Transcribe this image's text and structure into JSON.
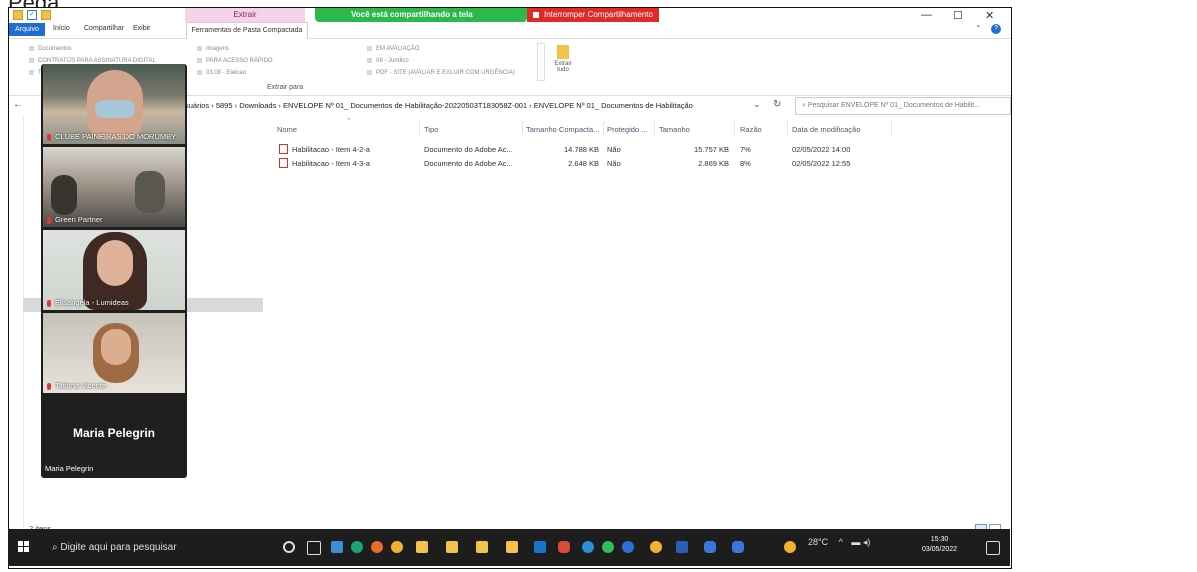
{
  "page": {
    "top_fragment": "Pega"
  },
  "window": {
    "extrair_tab": "Extrair",
    "share_notice": "Você está compartilhando a tela",
    "stop_share": "Interromper Compartilhamento",
    "minimize": "—",
    "maximize": "☐",
    "close": "✕"
  },
  "ribbon": {
    "tabs": [
      "Arquivo",
      "Início",
      "Compartilhar",
      "Exibir"
    ],
    "contextual_tab": "Ferramentas de Pasta Compactada",
    "help": "?",
    "collapse": "⌃",
    "group1": [
      "Documentos",
      "CONTRATOS PARA ASSINATURA DIGITAL",
      "TRAB"
    ],
    "group2": [
      "Imagens",
      "PARA ACESSO RÁPIDO",
      "03.08 - Eleicao"
    ],
    "group3": [
      "EM AVALIAÇÃO",
      "08 - Juridico",
      "PDF - SITE (AVALIAR E EXLUIR COM URGÊNCIA)"
    ],
    "extrair_tudo": "Extrair tudo",
    "extrair_para": "Extrair para"
  },
  "address": {
    "back": "←",
    "path": "suários  ›  5895  ›  Downloads  ›  ENVELOPE Nº 01_ Documentos de Habilitação-20220503T183058Z-001  ›  ENVELOPE Nº 01_ Documentos de Habilitação",
    "dropdown": "⌄",
    "refresh": "↻",
    "search_placeholder": "Pesquisar ENVELOPE Nº 01_ Documentos de Habilit..."
  },
  "columns": [
    "Nome",
    "Tipo",
    "Tamanho Compacta...",
    "Protegido ...",
    "Tamanho",
    "Razão",
    "Data de modificação"
  ],
  "files": [
    {
      "name": "Habilitacao - Item 4-2-a",
      "type": "Documento do Adobe Ac...",
      "compressed": "14.788 KB",
      "protected": "Não",
      "size": "15.757 KB",
      "ratio": "7%",
      "modified": "02/05/2022 14:00"
    },
    {
      "name": "Habilitacao - Item 4-3-a",
      "type": "Documento do Adobe Ac...",
      "compressed": "2.648 KB",
      "protected": "Não",
      "size": "2.869 KB",
      "ratio": "8%",
      "modified": "02/05/2022 12:55"
    }
  ],
  "status": {
    "items": "2 itens"
  },
  "participants": [
    {
      "name": "CLUBE PAINEIRAS DO MORUMBY"
    },
    {
      "name": "Green Partner"
    },
    {
      "name": "Elisangela - Lumideas"
    },
    {
      "name": "Tatiana Vicente"
    }
  ],
  "self_tile": {
    "big_name": "Maria Pelegrin",
    "small_name": "Maria Pelegrin"
  },
  "taskbar": {
    "search_placeholder": "Digite aqui para pesquisar",
    "weather": "28°C",
    "tray_arrow": "^",
    "time": "15:30",
    "date": "03/05/2022"
  }
}
